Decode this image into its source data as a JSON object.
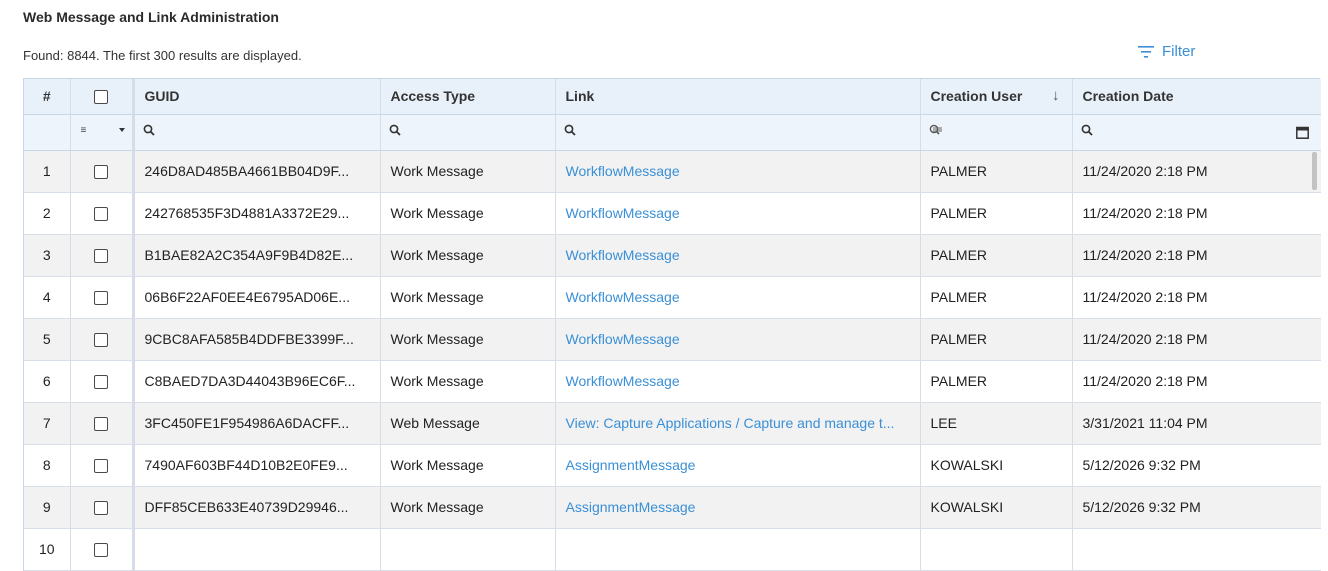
{
  "page": {
    "title": "Web Message and Link Administration",
    "found_text": "Found: 8844. The first 300 results are displayed.",
    "filter_label": "Filter"
  },
  "columns": {
    "num": "#",
    "guid": "GUID",
    "access_type": "Access Type",
    "link": "Link",
    "creation_user": "Creation User",
    "creation_date": "Creation Date"
  },
  "sort": {
    "column": "creation_user",
    "direction": "descending"
  },
  "colors": {
    "link": "#3a8fd6",
    "header_bg": "#e8f1fa",
    "row_alt": "#f2f2f2"
  },
  "rows": [
    {
      "num": "1",
      "guid": "246D8AD485BA4661BB04D9F...",
      "access_type": "Work Message",
      "link": "WorkflowMessage",
      "user": "PALMER",
      "date": "11/24/2020 2:18 PM"
    },
    {
      "num": "2",
      "guid": "242768535F3D4881A3372E29...",
      "access_type": "Work Message",
      "link": "WorkflowMessage",
      "user": "PALMER",
      "date": "11/24/2020 2:18 PM"
    },
    {
      "num": "3",
      "guid": "B1BAE82A2C354A9F9B4D82E...",
      "access_type": "Work Message",
      "link": "WorkflowMessage",
      "user": "PALMER",
      "date": "11/24/2020 2:18 PM"
    },
    {
      "num": "4",
      "guid": "06B6F22AF0EE4E6795AD06E...",
      "access_type": "Work Message",
      "link": "WorkflowMessage",
      "user": "PALMER",
      "date": "11/24/2020 2:18 PM"
    },
    {
      "num": "5",
      "guid": "9CBC8AFA585B4DDFBE3399F...",
      "access_type": "Work Message",
      "link": "WorkflowMessage",
      "user": "PALMER",
      "date": "11/24/2020 2:18 PM"
    },
    {
      "num": "6",
      "guid": "C8BAED7DA3D44043B96EC6F...",
      "access_type": "Work Message",
      "link": "WorkflowMessage",
      "user": "PALMER",
      "date": "11/24/2020 2:18 PM"
    },
    {
      "num": "7",
      "guid": "3FC450FE1F954986A6DACFF...",
      "access_type": "Web Message",
      "link": "View: Capture Applications / Capture and manage t...",
      "user": "LEE",
      "date": "3/31/2021 11:04 PM"
    },
    {
      "num": "8",
      "guid": "7490AF603BF44D10B2E0FE9...",
      "access_type": "Work Message",
      "link": "AssignmentMessage",
      "user": "KOWALSKI",
      "date": "5/12/2026 9:32 PM"
    },
    {
      "num": "9",
      "guid": "DFF85CEB633E40739D29946...",
      "access_type": "Work Message",
      "link": "AssignmentMessage",
      "user": "KOWALSKI",
      "date": "5/12/2026 9:32 PM"
    },
    {
      "num": "10",
      "guid": "",
      "access_type": "",
      "link": "",
      "user": "",
      "date": ""
    }
  ]
}
